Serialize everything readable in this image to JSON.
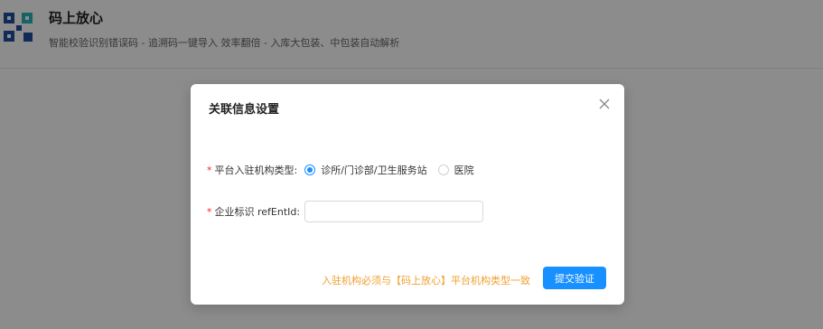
{
  "app": {
    "name": "码上放心",
    "tagline": "智能校验识别错误码 - 追溯码一键导入 效率翻倍 - 入库大包装、中包装自动解析",
    "logo_icon": "qr-logo-icon"
  },
  "modal": {
    "title": "关联信息设置",
    "close_icon": "close-icon",
    "fields": {
      "institution_type": {
        "required_mark": "*",
        "label": "平台入驻机构类型:",
        "options": [
          {
            "label": "诊所/门诊部/卫生服务站",
            "checked": true
          },
          {
            "label": "医院",
            "checked": false
          }
        ]
      },
      "ref_ent_id": {
        "required_mark": "*",
        "label": "企业标识 refEntId:",
        "value": "",
        "placeholder": ""
      }
    },
    "footer_note": "入驻机构必须与【码上放心】平台机构类型一致",
    "submit_label": "提交验证"
  },
  "colors": {
    "primary": "#1890ff",
    "warning_text": "#f0a030",
    "required": "#f5222d",
    "logo_blue": "#1f4fa3",
    "logo_teal": "#2bb3b8"
  }
}
